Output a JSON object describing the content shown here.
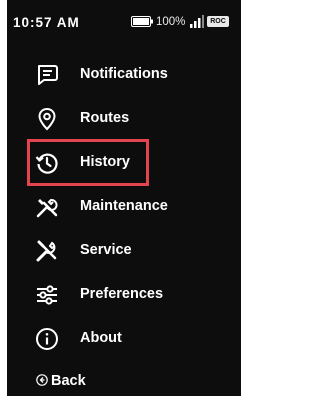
{
  "status_bar": {
    "time": "10:57 AM",
    "battery_percent": "100%",
    "battery_icon": "battery-icon",
    "signal_icon": "signal-icon",
    "badge": "ROC"
  },
  "menu": {
    "items": [
      {
        "label": "Notifications",
        "icon": "notifications-icon"
      },
      {
        "label": "Routes",
        "icon": "location-pin-icon"
      },
      {
        "label": "History",
        "icon": "history-icon",
        "highlighted": true
      },
      {
        "label": "Maintenance",
        "icon": "maintenance-tools-icon"
      },
      {
        "label": "Service",
        "icon": "service-tools-icon"
      },
      {
        "label": "Preferences",
        "icon": "preferences-sliders-icon"
      },
      {
        "label": "About",
        "icon": "info-icon"
      }
    ]
  },
  "back": {
    "label": "Back",
    "icon": "back-arrow-icon"
  },
  "colors": {
    "background": "#0d0d0d",
    "text": "#ffffff",
    "highlight_border": "#e2454e"
  }
}
